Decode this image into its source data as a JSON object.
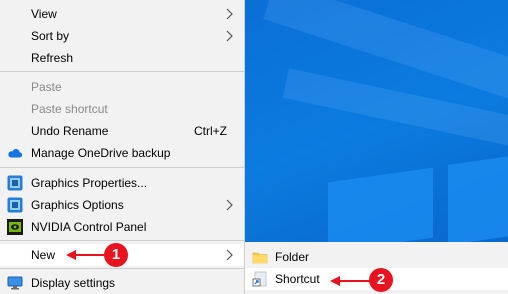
{
  "menu": {
    "items": [
      {
        "label": "View",
        "submenu": true
      },
      {
        "label": "Sort by",
        "submenu": true
      },
      {
        "label": "Refresh"
      },
      {
        "label": "Paste",
        "disabled": true
      },
      {
        "label": "Paste shortcut",
        "disabled": true
      },
      {
        "label": "Undo Rename",
        "shortcut": "Ctrl+Z"
      },
      {
        "label": "Manage OneDrive backup",
        "icon": "onedrive-cloud-icon"
      },
      {
        "label": "Graphics Properties...",
        "icon": "intel-graphics-icon"
      },
      {
        "label": "Graphics Options",
        "icon": "intel-graphics-icon",
        "submenu": true
      },
      {
        "label": "NVIDIA Control Panel",
        "icon": "nvidia-icon"
      },
      {
        "label": "New",
        "submenu": true,
        "highlighted": true
      },
      {
        "label": "Display settings",
        "icon": "display-settings-icon"
      }
    ]
  },
  "submenu": {
    "items": [
      {
        "label": "Folder",
        "icon": "folder-icon"
      },
      {
        "label": "Shortcut",
        "icon": "shortcut-icon",
        "active": true
      }
    ]
  },
  "annotations": {
    "step1": "1",
    "step2": "2",
    "color": "#e8131e"
  }
}
